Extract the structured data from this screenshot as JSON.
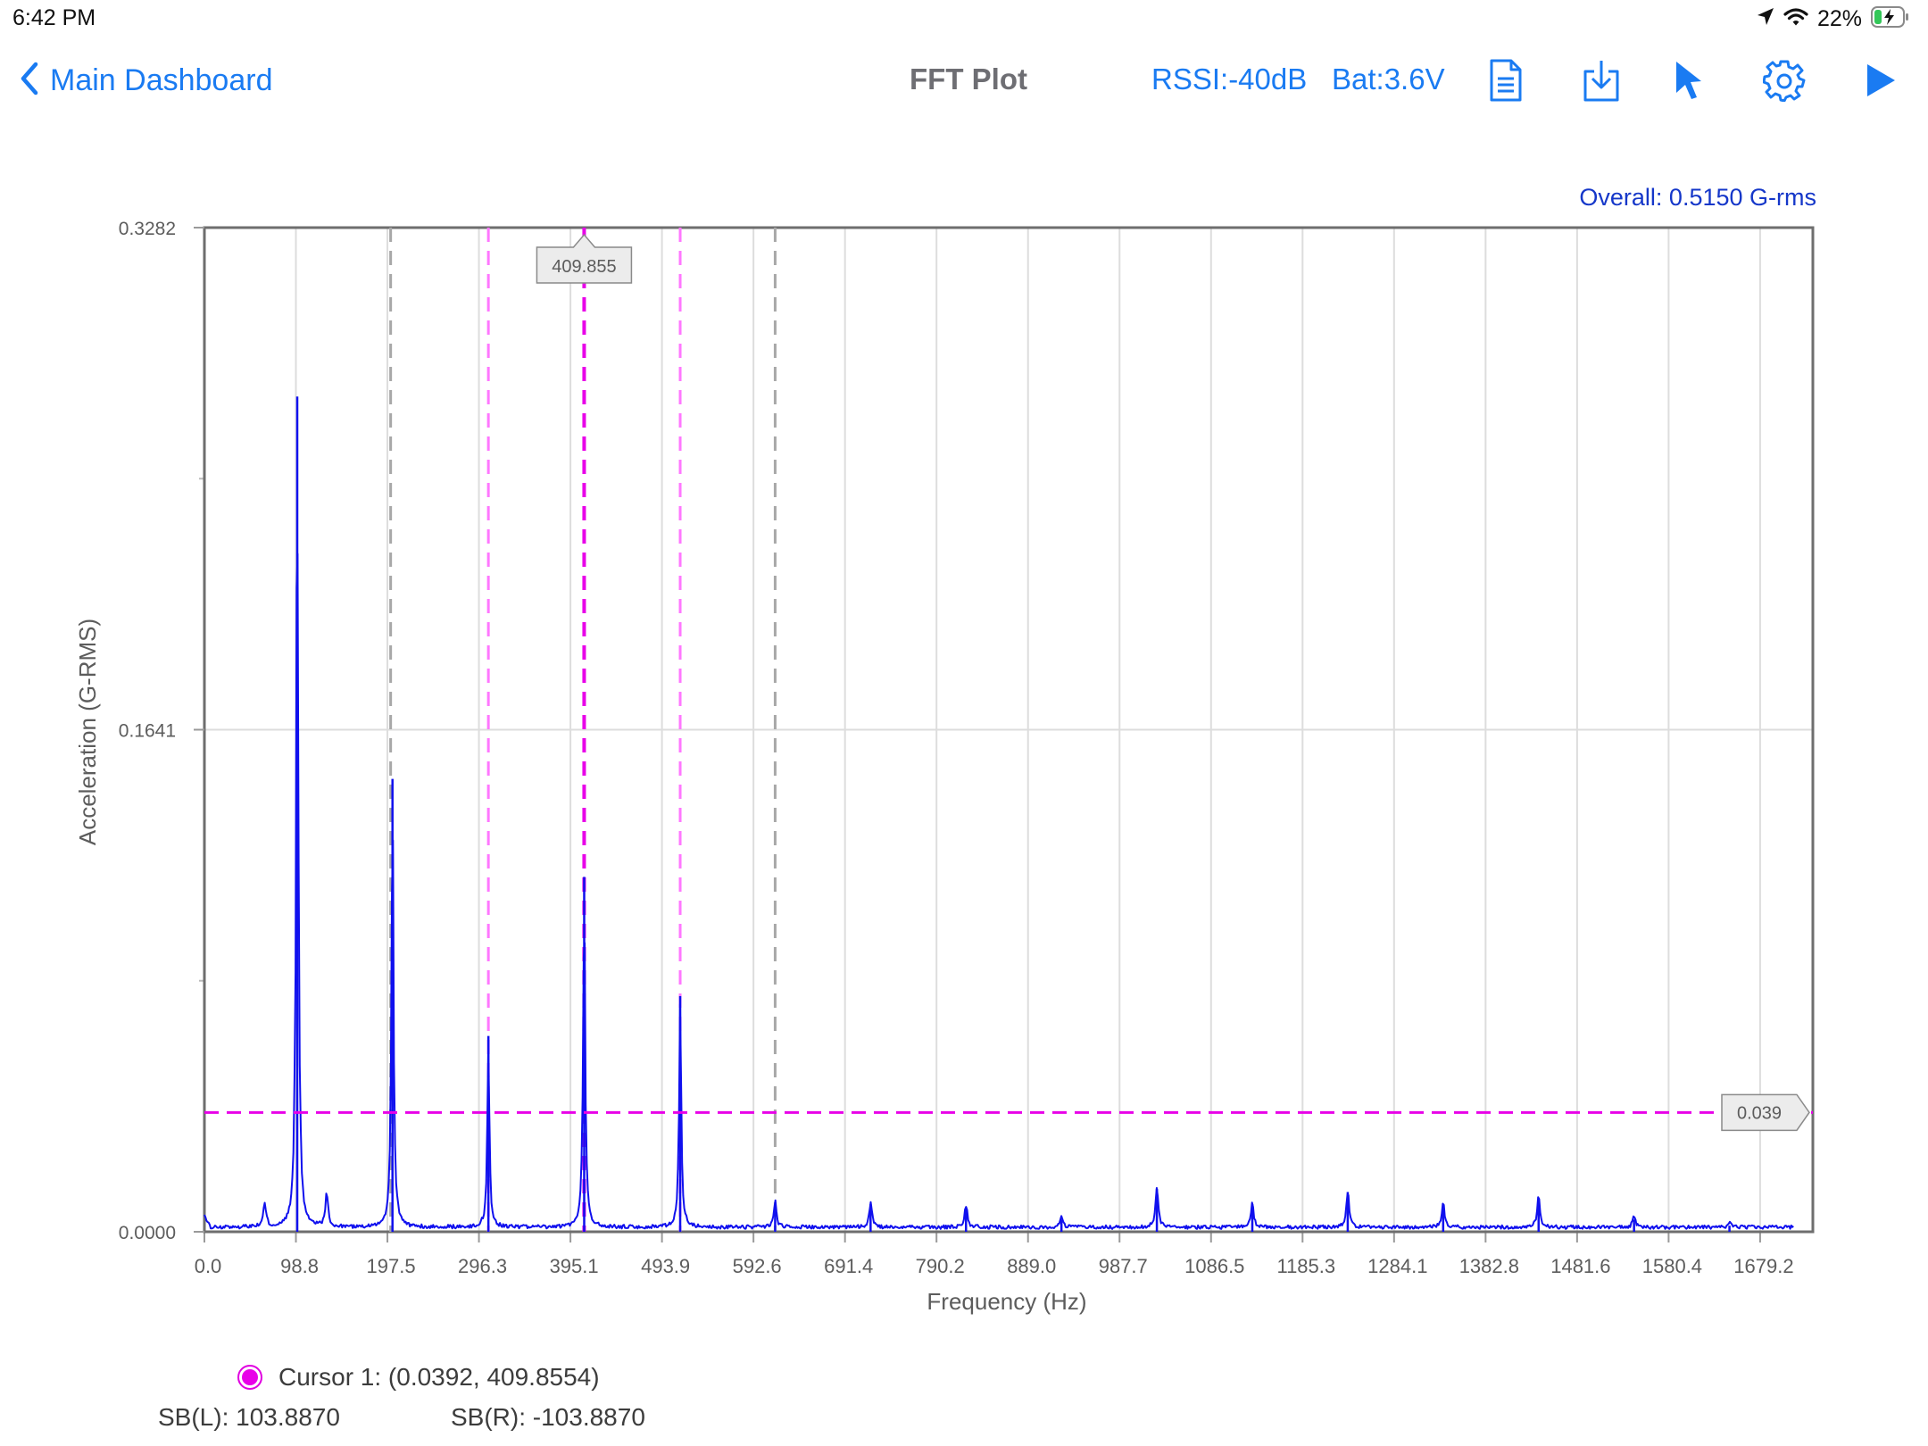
{
  "status_bar": {
    "time": "6:42 PM",
    "battery_percent": "22%",
    "icons": [
      "location-arrow-icon",
      "wifi-icon",
      "battery-charging-icon"
    ]
  },
  "nav": {
    "back_label": "Main Dashboard",
    "title": "FFT Plot",
    "rssi": "RSSI:-40dB",
    "battery": "Bat:3.6V",
    "toolbar_icons": [
      "report-document-icon",
      "download-icon",
      "cursor-pointer-icon",
      "settings-gear-icon",
      "play-icon"
    ],
    "accent_color": "#1a7bf2"
  },
  "overall": "Overall: 0.5150 G-rms",
  "chart_data": {
    "type": "line",
    "title": "",
    "xlabel": "Frequency (Hz)",
    "ylabel": "Acceleration (G-RMS)",
    "xlim": [
      0.0,
      1736
    ],
    "ylim": [
      0.0,
      0.3282
    ],
    "x_ticks": [
      "0.0",
      "98.8",
      "197.5",
      "296.3",
      "395.1",
      "493.9",
      "592.6",
      "691.4",
      "790.2",
      "889.0",
      "987.7",
      "1086.5",
      "1185.3",
      "1284.1",
      "1382.8",
      "1481.6",
      "1580.4",
      "1679.2"
    ],
    "y_ticks": [
      "0.0000",
      "0.1641",
      "0.3282"
    ],
    "grid": true,
    "series_color": "#1010ee",
    "peaks": [
      {
        "x": 100.2,
        "y": 0.273
      },
      {
        "x": 203.0,
        "y": 0.148
      },
      {
        "x": 306.5,
        "y": 0.064
      },
      {
        "x": 409.9,
        "y": 0.116
      },
      {
        "x": 513.5,
        "y": 0.077
      },
      {
        "x": 616.0,
        "y": 0.009
      },
      {
        "x": 719.0,
        "y": 0.009
      },
      {
        "x": 822.0,
        "y": 0.008
      },
      {
        "x": 925.0,
        "y": 0.004
      },
      {
        "x": 1028.0,
        "y": 0.014
      },
      {
        "x": 1131.0,
        "y": 0.009
      },
      {
        "x": 1234.0,
        "y": 0.013
      },
      {
        "x": 1337.0,
        "y": 0.009
      },
      {
        "x": 1440.0,
        "y": 0.011
      },
      {
        "x": 1543.0,
        "y": 0.004
      },
      {
        "x": 1646.0,
        "y": 0.002
      }
    ],
    "small_peaks": [
      {
        "x": 65.0,
        "y": 0.009
      },
      {
        "x": 132.0,
        "y": 0.012
      }
    ],
    "gray_cursor_lines_x": [
      201.0,
      616.0
    ],
    "magenta_sideband_lines_x": [
      306.5,
      513.5
    ],
    "cursor_x": 409.855,
    "cursor_y": 0.039,
    "cursor_x_label": "409.855",
    "cursor_y_label": "0.039",
    "cursor_color": "#e800e8"
  },
  "cursor_readout": {
    "cursor1": "Cursor 1: (0.0392, 409.8554)",
    "sb_left": "SB(L): 103.8870",
    "sb_right": "SB(R): -103.8870"
  }
}
